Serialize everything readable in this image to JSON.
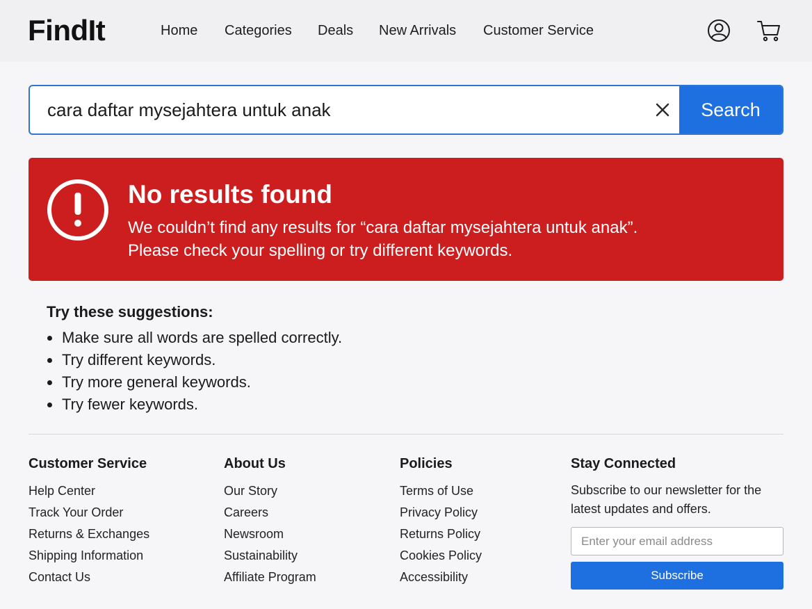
{
  "brand": {
    "logo_text": "FindIt"
  },
  "nav": {
    "items": [
      {
        "label": "Home"
      },
      {
        "label": "Categories"
      },
      {
        "label": "Deals"
      },
      {
        "label": "New Arrivals"
      },
      {
        "label": "Customer Service"
      }
    ]
  },
  "header_icons": {
    "account": "user-circle-icon",
    "cart": "shopping-cart-icon"
  },
  "search": {
    "value": "cara daftar mysejahtera untuk anak",
    "clear_icon": "close-icon",
    "button_label": "Search"
  },
  "alert": {
    "icon": "exclamation-circle-icon",
    "title": "No results found",
    "line1": "We couldn’t find any results for “cara daftar mysejahtera untuk anak”.",
    "line2": "Please check your spelling or try different keywords.",
    "color": "#cc1e1f"
  },
  "suggestions": {
    "title": "Try these suggestions:",
    "items": [
      "Make sure all words are spelled correctly.",
      "Try different keywords.",
      "Try more general keywords.",
      "Try fewer keywords."
    ]
  },
  "footer": {
    "columns": [
      {
        "heading": "Customer Service",
        "links": [
          "Help Center",
          "Track Your Order",
          "Returns & Exchanges",
          "Shipping Information",
          "Contact Us"
        ]
      },
      {
        "heading": "About Us",
        "links": [
          "Our Story",
          "Careers",
          "Newsroom",
          "Sustainability",
          "Affiliate Program"
        ]
      },
      {
        "heading": "Policies",
        "links": [
          "Terms of Use",
          "Privacy Policy",
          "Returns Policy",
          "Cookies Policy",
          "Accessibility"
        ]
      }
    ],
    "newsletter": {
      "heading": "Stay Connected",
      "text": "Subscribe to our newsletter for the latest updates and offers.",
      "email_placeholder": "Enter your email address",
      "button_label": "Subscribe"
    }
  },
  "colors": {
    "accent": "#1e6fe0",
    "error": "#cc1e1f"
  }
}
